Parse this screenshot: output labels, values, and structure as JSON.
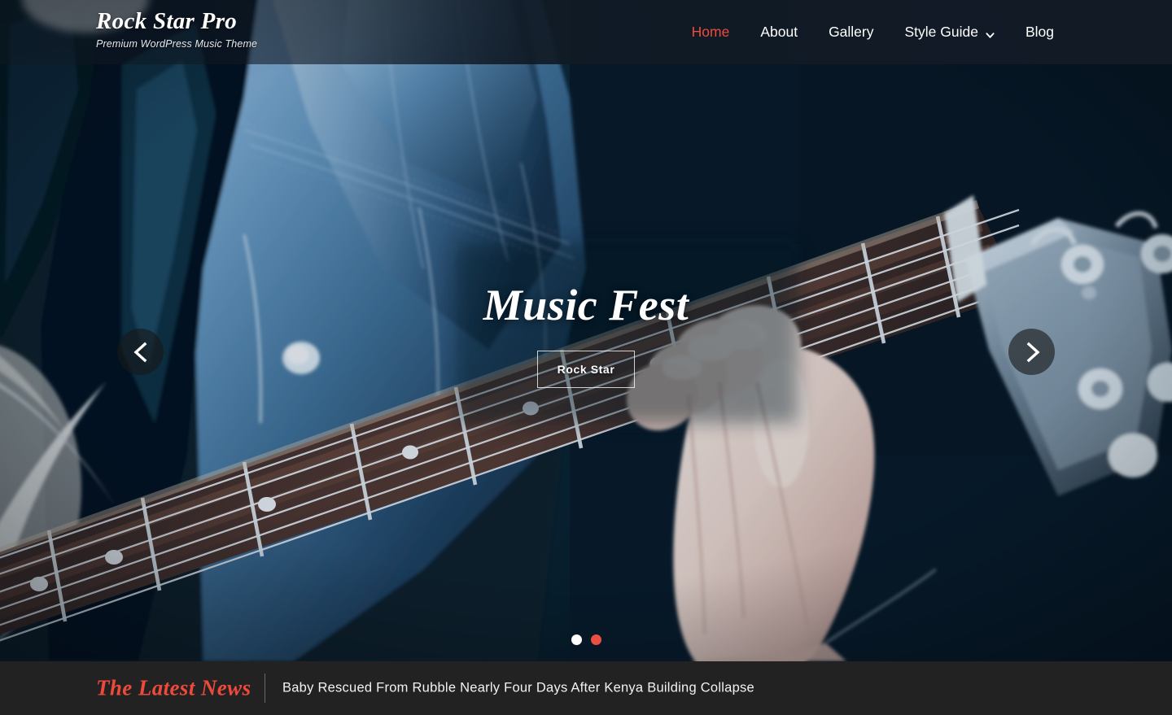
{
  "header": {
    "site_title": "Rock Star Pro",
    "tagline": "Premium WordPress Music Theme",
    "nav": [
      {
        "label": "Home",
        "active": true,
        "has_dropdown": false
      },
      {
        "label": "About",
        "active": false,
        "has_dropdown": false
      },
      {
        "label": "Gallery",
        "active": false,
        "has_dropdown": false
      },
      {
        "label": "Style Guide",
        "active": false,
        "has_dropdown": true
      },
      {
        "label": "Blog",
        "active": false,
        "has_dropdown": false
      }
    ],
    "accent_color": "#ef4a3d",
    "bar_color": "#131c26"
  },
  "hero": {
    "slide_title": "Music Fest",
    "button_label": "Rock Star",
    "prev_icon": "chevron-left-icon",
    "next_icon": "chevron-right-icon",
    "image_description": "Close-up of a musician in a leather jacket playing an acoustic guitar, blue tinted",
    "dots": [
      {
        "active": false
      },
      {
        "active": true
      }
    ],
    "active_dot_color": "#eb4f42"
  },
  "newsbar": {
    "label": "The Latest News",
    "headline": "Baby Rescued From Rubble Nearly Four Days After Kenya Building Collapse",
    "background_color": "#222222",
    "label_color": "#ee4a3c"
  }
}
